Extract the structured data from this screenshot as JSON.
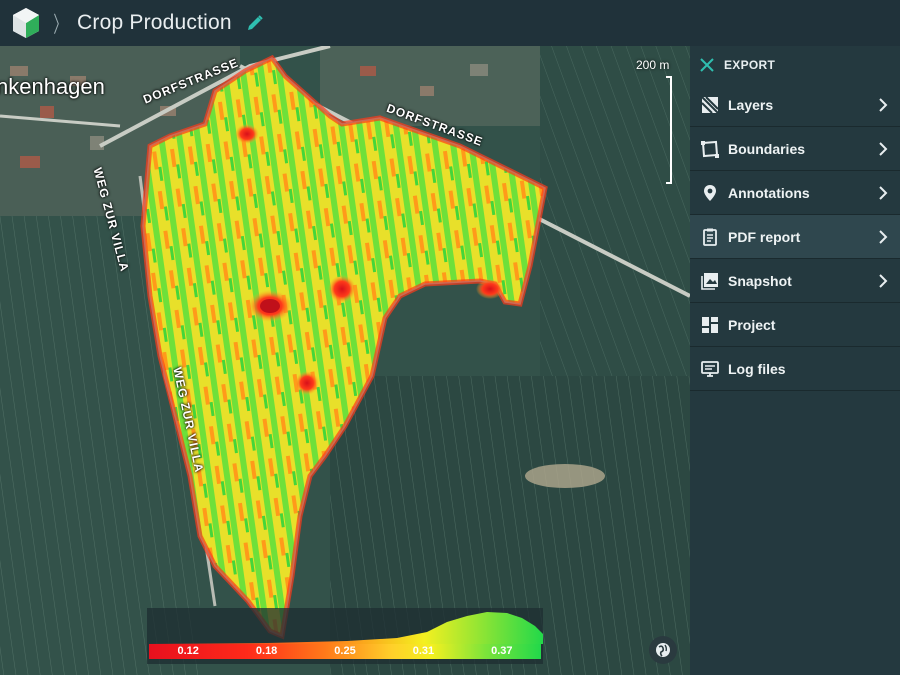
{
  "header": {
    "title": "Crop Production"
  },
  "map": {
    "town_label": "nkenhagen",
    "road_labels": [
      "DORFSTRASSE",
      "DORFSTRASSE",
      "WEG ZUR VILLA",
      "WEG ZUR VILLA"
    ],
    "scale_label": "200 m",
    "legend": {
      "ticks": [
        "0.12",
        "0.18",
        "0.25",
        "0.31",
        "0.37"
      ]
    }
  },
  "sidebar": {
    "header_label": "EXPORT",
    "items": [
      {
        "label": "Layers",
        "icon": "layers-icon",
        "has_chevron": true
      },
      {
        "label": "Boundaries",
        "icon": "boundaries-icon",
        "has_chevron": true
      },
      {
        "label": "Annotations",
        "icon": "pin-icon",
        "has_chevron": true
      },
      {
        "label": "PDF report",
        "icon": "document-icon",
        "has_chevron": true,
        "active": true
      },
      {
        "label": "Snapshot",
        "icon": "image-icon",
        "has_chevron": true
      },
      {
        "label": "Project",
        "icon": "grid-icon",
        "has_chevron": false
      },
      {
        "label": "Log files",
        "icon": "monitor-icon",
        "has_chevron": false
      }
    ]
  },
  "colors": {
    "accent": "#2fbfb0",
    "topbar": "#20323a",
    "sidebar": "#24393f"
  }
}
